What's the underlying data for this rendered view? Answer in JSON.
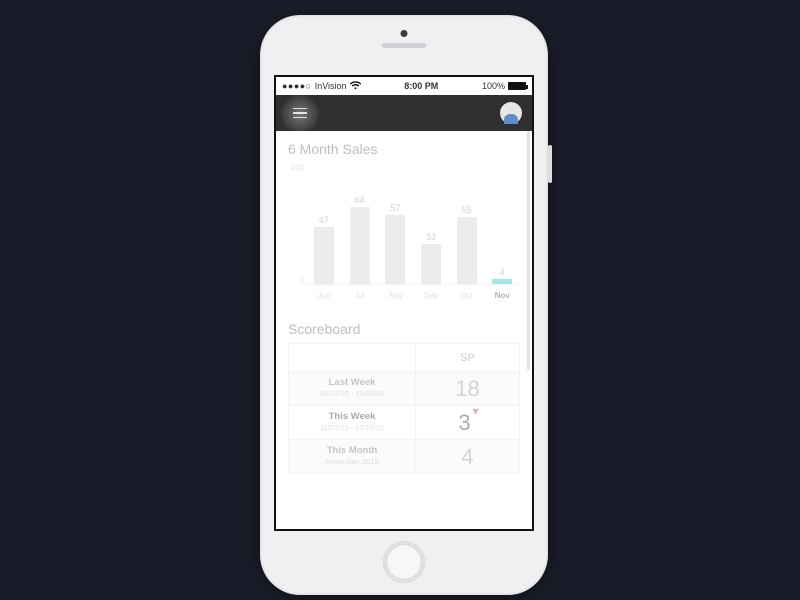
{
  "statusbar": {
    "carrier": "InVision",
    "signal_dots": "●●●●○",
    "time": "8:00 PM",
    "battery_pct": "100%"
  },
  "header": {
    "menu_icon": "hamburger-icon",
    "avatar_icon": "avatar-icon"
  },
  "sales": {
    "title": "6 Month Sales"
  },
  "chart_data": {
    "type": "bar",
    "categories": [
      "Jun",
      "Jul",
      "Aug",
      "Sep",
      "Oct",
      "Nov"
    ],
    "values": [
      47,
      64,
      57,
      33,
      55,
      4
    ],
    "value_labels": [
      "47",
      "64",
      "57",
      "33",
      "55",
      "4"
    ],
    "current_index": 5,
    "title": "6 Month Sales",
    "xlabel": "",
    "ylabel": "",
    "ylim": [
      0,
      100
    ],
    "yticks": [
      "100",
      "0"
    ],
    "colors": {
      "bar": "#d6d6d6",
      "current_bar": "#3cc7bf"
    }
  },
  "scoreboard": {
    "title": "Scoreboard",
    "column_header": "SP",
    "rows": [
      {
        "label": "Last Week",
        "sub": "10/27/15 - 11/02/15",
        "value": "18",
        "highlight": false
      },
      {
        "label": "This Week",
        "sub": "11/03/15 - 11/10/15",
        "value": "3",
        "highlight": true,
        "trend": "down"
      },
      {
        "label": "This Month",
        "sub": "November 2015",
        "value": "4",
        "highlight": false
      }
    ]
  }
}
